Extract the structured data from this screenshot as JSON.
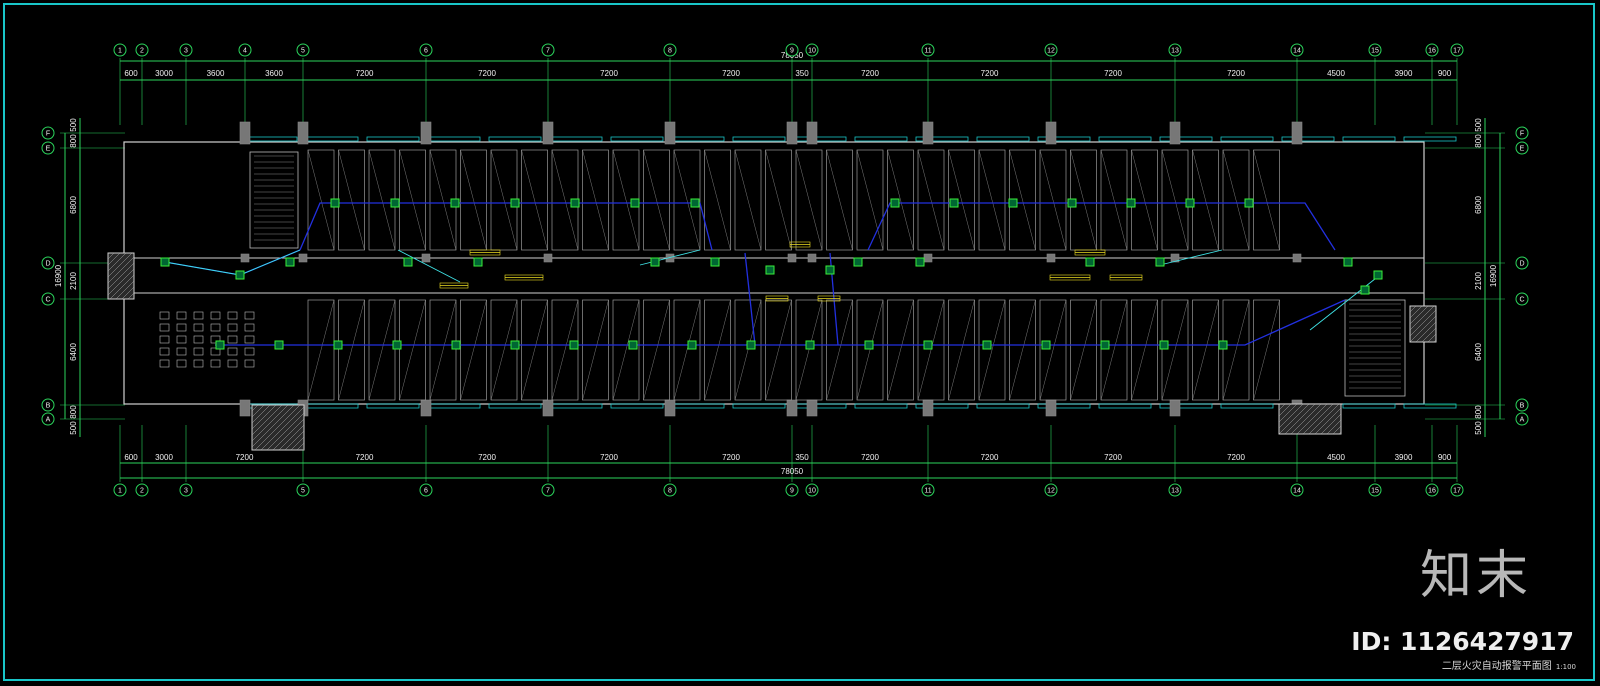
{
  "axes_top": [
    "1",
    "2",
    "3",
    "4",
    "5",
    "6",
    "7",
    "8",
    "9",
    "10",
    "11",
    "12",
    "13",
    "14",
    "15",
    "16",
    "17"
  ],
  "axes_bottom": [
    "1",
    "2",
    "3",
    "5",
    "6",
    "7",
    "8",
    "9",
    "10",
    "11",
    "12",
    "13",
    "14",
    "15",
    "16",
    "17"
  ],
  "axes_side": [
    "F",
    "E",
    "D",
    "C",
    "B",
    "A"
  ],
  "dims_top": [
    "600",
    "3000",
    "3600",
    "3600",
    "7200",
    "7200",
    "7200",
    "7200",
    "350",
    "7200",
    "7200",
    "7200",
    "7200",
    "4500",
    "3900",
    "900"
  ],
  "total_top": "78050",
  "dims_bottom": [
    "600",
    "3000",
    "7200",
    "7200",
    "7200",
    "7200",
    "7200",
    "350",
    "7200",
    "7200",
    "7200",
    "7200",
    "4500",
    "3900",
    "900"
  ],
  "total_bottom": "78050",
  "dims_side": [
    "500",
    "800",
    "6800",
    "2100",
    "6400",
    "800",
    "500"
  ],
  "total_side": "16900",
  "brand_text": "知末",
  "id_text": "ID: 1126427917",
  "drawing_title": "二层火灾自动报警平面图",
  "drawing_scale": "1:100",
  "colors": {
    "frame": "#19c6c9",
    "wall": "#d0d0d0",
    "dimension": "#2bd45c",
    "wiring": "#2230e0",
    "device": "#3aee3a",
    "label": "#f0e020"
  }
}
